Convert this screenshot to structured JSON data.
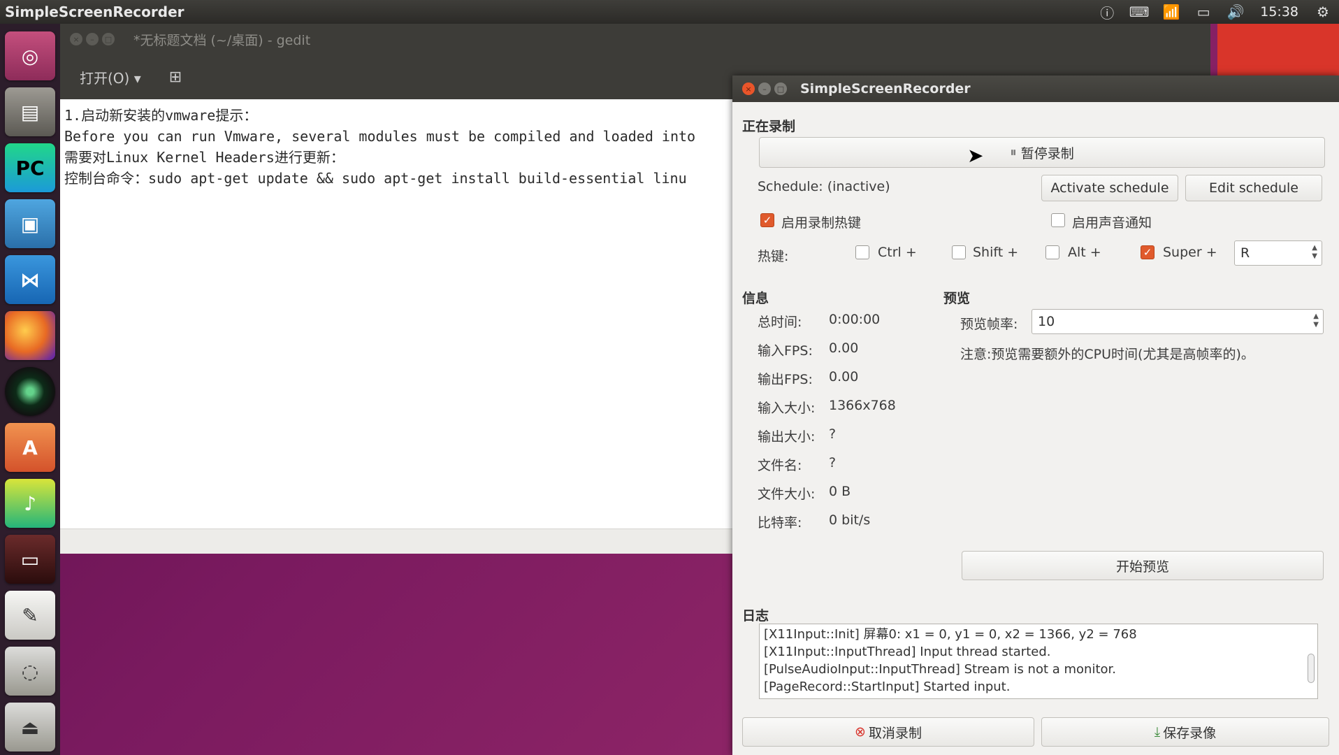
{
  "topbar": {
    "app_title": "SimpleScreenRecorder",
    "clock": "15:38"
  },
  "gedit": {
    "title": "*无标题文档 (~/桌面) - gedit",
    "open_label": "打开(O)",
    "lines": [
      "1.启动新安装的vmware提示：",
      "Before you can run Vmware, several modules must be compiled and loaded into",
      "",
      "需要对Linux Kernel Headers进行更新：",
      "",
      "控制台命令：sudo apt-get update && sudo apt-get install build-essential linu"
    ]
  },
  "ssr": {
    "title": "SimpleScreenRecorder",
    "recording_section": "正在录制",
    "pause_button": "暂停录制",
    "schedule_status": "Schedule: (inactive)",
    "activate_schedule": "Activate schedule",
    "edit_schedule": "Edit schedule",
    "enable_hotkey": "启用录制热键",
    "enable_sound": "启用声音通知",
    "hotkey_label": "热键:",
    "ctrl": "Ctrl +",
    "shift": "Shift +",
    "alt": "Alt +",
    "super": "Super +",
    "hotkey_key": "R",
    "info_section": "信息",
    "preview_section": "预览",
    "info": [
      {
        "label": "总时间:",
        "value": "0:00:00"
      },
      {
        "label": "输入FPS:",
        "value": "0.00"
      },
      {
        "label": "输出FPS:",
        "value": "0.00"
      },
      {
        "label": "输入大小:",
        "value": "1366x768"
      },
      {
        "label": "输出大小:",
        "value": "?"
      },
      {
        "label": "文件名:",
        "value": "?"
      },
      {
        "label": "文件大小:",
        "value": "0 B"
      },
      {
        "label": "比特率:",
        "value": "0 bit/s"
      }
    ],
    "preview_rate_label": "预览帧率:",
    "preview_rate_value": "10",
    "preview_note": "注意:预览需要额外的CPU时间(尤其是高帧率的)。",
    "start_preview": "开始预览",
    "log_section": "日志",
    "log_lines": [
      "[X11Input::Init] 屏幕0: x1 = 0, y1 = 0, x2 = 1366, y2 = 768",
      "[X11Input::InputThread] Input thread started.",
      "[PulseAudioInput::InputThread] Stream is not a monitor.",
      "[PageRecord::StartInput] Started input."
    ],
    "cancel_recording": "取消录制",
    "save_recording": "保存录像"
  }
}
